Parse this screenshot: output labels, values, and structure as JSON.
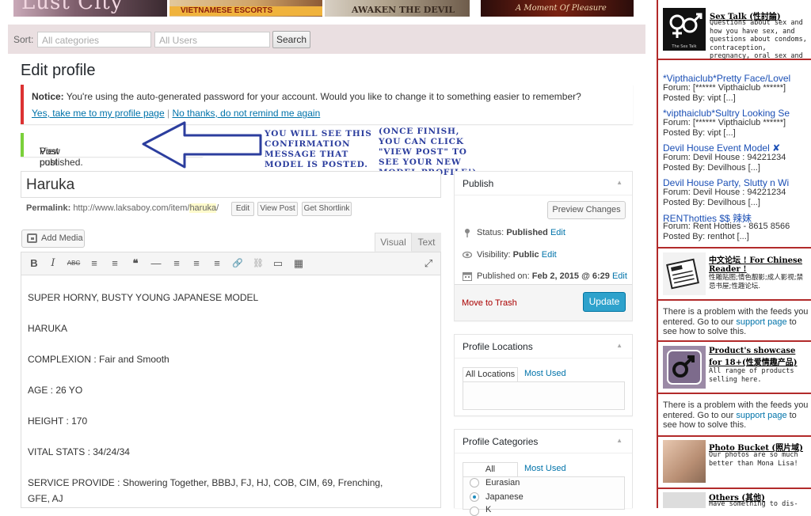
{
  "banners": {
    "b1": "Lust City",
    "b2": "VIETNAMESE ESCORTS",
    "b3": "AWAKEN THE DEVIL WITHIN",
    "b4": "A Moment Of Pleasure"
  },
  "sortbar": {
    "label": "Sort:",
    "categories_placeholder": "All categories",
    "users_placeholder": "All Users",
    "search_button": "Search"
  },
  "page_title": "Edit profile",
  "notice": {
    "bold": "Notice:",
    "message": "You're using the auto-generated password for your account. Would you like to change it to something easier to remember?",
    "yes_link": "Yes, take me to my profile page",
    "separator": "|",
    "no_link": "No thanks, do not remind me again"
  },
  "updated": {
    "message": "Post published.",
    "view_link": "View post"
  },
  "annotations": {
    "left": "You will see this confirmation message that model is posted. It may take some time, please be patient.",
    "right": "(Once finish, you can click \"view post\" to see your new model profile!)"
  },
  "editor": {
    "title_value": "Haruka",
    "permalink_label": "Permalink:",
    "permalink_base": "http://www.laksaboy.com/item/",
    "permalink_slug": "haruka",
    "permalink_trail": "/",
    "edit_btn": "Edit",
    "view_post_btn": "View Post",
    "shortlink_btn": "Get Shortlink",
    "add_media": "Add Media",
    "tab_visual": "Visual",
    "tab_text": "Text",
    "toolbar": {
      "bold": "B",
      "italic": "I",
      "strike": "ABC",
      "ul": "≡",
      "ol": "≡",
      "quote": "❝",
      "hr": "—",
      "align_left": "≡",
      "align_center": "≡",
      "align_right": "≡",
      "link": "🔗",
      "unlink": "⛓",
      "more": "▭",
      "kitchen_sink": "▦",
      "fullscreen": "⤢"
    },
    "lines": [
      "SUPER HORNY, BUSTY YOUNG JAPANESE MODEL",
      "HARUKA",
      "COMPLEXION : Fair and Smooth",
      "AGE : 26 YO",
      "HEIGHT : 170",
      "VITAL STATS : 34/24/34",
      "SERVICE PROVIDE : Showering Together, BBBJ, FJ, HJ, COB, CIM, 69, Frenching,",
      "GFE, AJ"
    ]
  },
  "publish_box": {
    "title": "Publish",
    "preview_btn": "Preview Changes",
    "status_label": "Status:",
    "status_value": "Published",
    "visibility_label": "Visibility:",
    "visibility_value": "Public",
    "published_label": "Published on:",
    "published_value": "Feb 2, 2015 @ 6:29",
    "edit": "Edit",
    "trash": "Move to Trash",
    "update": "Update"
  },
  "locations_box": {
    "title": "Profile Locations",
    "tab_all": "All Locations",
    "tab_used": "Most Used"
  },
  "categories_box": {
    "title": "Profile Categories",
    "tab_all": "All Categories",
    "tab_used": "Most Used",
    "options": [
      "Eurasian",
      "Japanese",
      "K"
    ],
    "selected": "Japanese"
  },
  "sidebar": {
    "sextalk": {
      "title": "Sex Talk (性討論)",
      "desc": "Questions about sex and how you have sex, and questions about condoms, contraception, pregnancy, oral sex and the age of consent.",
      "thumb_caption": "The Sex Talk"
    },
    "feed": [
      {
        "title": "*Vipthaiclub*Pretty Face/Lovel",
        "forum": "Forum: [****** Vipthaiclub ******]",
        "poster": "Posted By: vipt [...]"
      },
      {
        "title": "*vipthaiclub*Sultry Looking Se",
        "forum": "Forum: [****** Vipthaiclub ******]",
        "poster": "Posted By: vipt [...]"
      },
      {
        "title": "Devil House Event Model ✘",
        "forum": "Forum: Devil House : 94221234",
        "poster": "Posted By: Devilhous [...]"
      },
      {
        "title": "Devil House Party, Slutty n Wi",
        "forum": "Forum: Devil House : 94221234",
        "poster": "Posted By: Devilhous [...]"
      },
      {
        "title": "RENThotties $$ 辣妹",
        "forum": "Forum: Rent Hotties - 8615 8566",
        "poster": "Posted By: renthot [...]"
      }
    ],
    "chinese": {
      "title": "中文论坛 ! For Chinese Reader !",
      "desc": "性雕贴图;情色靓影;成人影视;禁忌书屋;性趣论坛."
    },
    "problem1": {
      "before": "There is a problem with the feeds you entered. Go to our",
      "link": "support page",
      "after": "to see how to solve this."
    },
    "products": {
      "title": "Product's showcase for 18+(性爱情趣产品)",
      "desc": "All range of products selling here."
    },
    "problem2": {
      "before": "There is a problem with the feeds you entered. Go to our",
      "link": "support page",
      "after": "to see how to solve this."
    },
    "photobucket": {
      "title": "Photo Bucket (照片域)",
      "desc": "Our photos are so much better than Mona Lisa!"
    },
    "others": {
      "title": "Others (其他)",
      "desc": "Have something to dis-"
    }
  }
}
